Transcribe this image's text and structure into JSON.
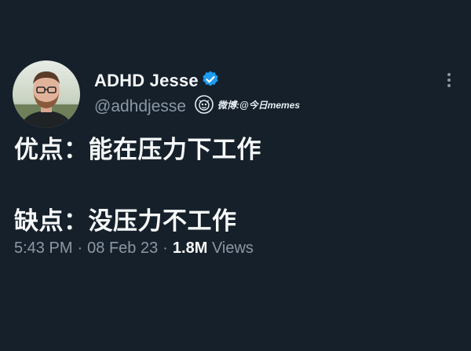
{
  "author": {
    "display_name": "ADHD Jesse",
    "handle": "@adhdjesse",
    "verified": true
  },
  "watermark": {
    "text": "微博:@今日memes"
  },
  "tweet": {
    "lines": [
      "优点：能在压力下工作",
      "缺点：没压力不工作"
    ]
  },
  "meta": {
    "time": "5:43 PM",
    "separator": "·",
    "date": "08 Feb 23",
    "views_count": "1.8M",
    "views_label": "Views"
  },
  "icons": {
    "verified": "verified-badge-icon",
    "more": "more-vertical-icon",
    "watermark": "weibo-logo-icon"
  },
  "colors": {
    "background": "#15202b",
    "text_primary": "#f7f9f9",
    "text_secondary": "#8b98a5",
    "verified_blue": "#1d9bf0"
  }
}
